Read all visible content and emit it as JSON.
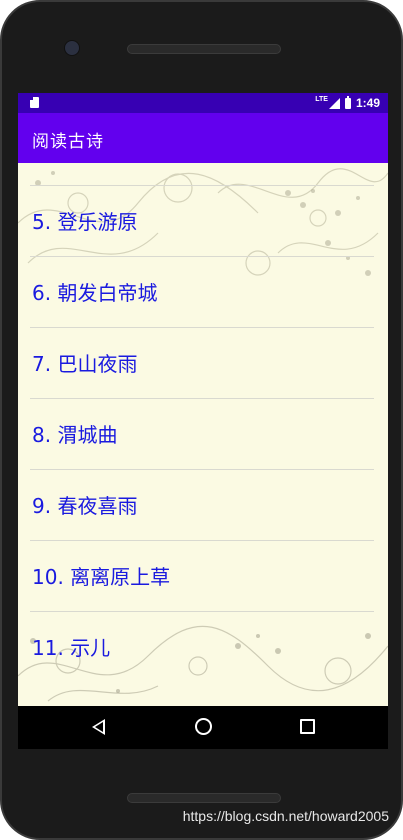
{
  "status_bar": {
    "network": "LTE",
    "time": "1:49"
  },
  "app_bar": {
    "title": "阅读古诗"
  },
  "poems": [
    {
      "label": "5. 登乐游原"
    },
    {
      "label": "6. 朝发白帝城"
    },
    {
      "label": "7. 巴山夜雨"
    },
    {
      "label": "8. 渭城曲"
    },
    {
      "label": "9. 春夜喜雨"
    },
    {
      "label": "10. 离离原上草"
    },
    {
      "label": "11. 示儿"
    }
  ],
  "watermark": "https://blog.csdn.net/howard2005",
  "colors": {
    "status_bar": "#3700b3",
    "app_bar": "#6200ee",
    "list_text": "#1a1adf",
    "background": "#fbfae3"
  }
}
